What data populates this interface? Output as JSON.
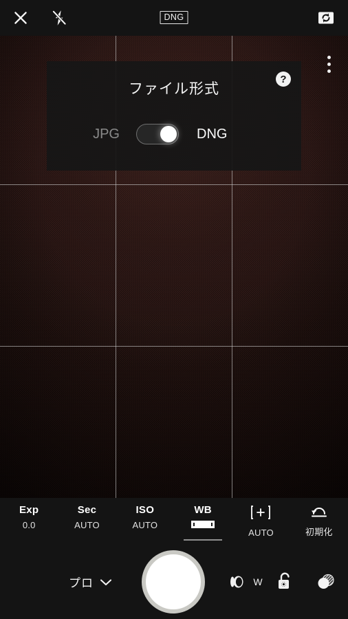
{
  "app": {
    "mode_label": "プロ",
    "format_badge": "DNG"
  },
  "topbar": {
    "close_icon": "close-icon",
    "flash_icon": "flash-off-icon",
    "format_badge": "DNG",
    "flip_icon": "camera-switch-icon"
  },
  "viewfinder": {
    "overflow_icon": "more-vertical-icon",
    "grid": "rule-of-thirds"
  },
  "dialog": {
    "title": "ファイル形式",
    "help_icon": "help-circle-icon",
    "option_left": "JPG",
    "option_right": "DNG",
    "toggle_state": "on",
    "selected": "DNG"
  },
  "pro_controls": [
    {
      "key": "Exp",
      "value": "0.0",
      "selected": false,
      "icon": ""
    },
    {
      "key": "Sec",
      "value": "AUTO",
      "selected": false,
      "icon": ""
    },
    {
      "key": "ISO",
      "value": "AUTO",
      "selected": false,
      "icon": ""
    },
    {
      "key": "WB",
      "value": "",
      "selected": true,
      "icon": "white-balance-icon"
    },
    {
      "key": "[+]",
      "value": "AUTO",
      "selected": false,
      "icon": "focus-brackets-icon"
    },
    {
      "key": "",
      "value": "初期化",
      "selected": false,
      "icon": "undo-reset-icon"
    }
  ],
  "bottom_bar": {
    "mode_label": "プロ",
    "mode_chevron_icon": "chevron-down-icon",
    "shutter_icon": "shutter-button",
    "lens_icon": "lens-icon",
    "lens_label": "W",
    "lock_icon": "unlocked-settings-icon",
    "gallery_icon": "gallery-thumbnail-icon"
  },
  "colors": {
    "bar_background": "#141414",
    "accent_white": "#ffffff",
    "dimmed_text": "#8a8a8a",
    "grid_line": "#c9c9c9"
  }
}
